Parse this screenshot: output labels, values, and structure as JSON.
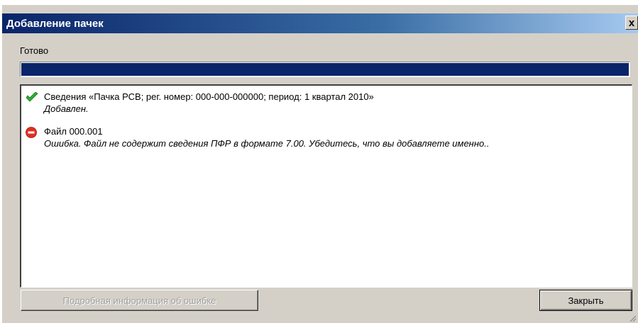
{
  "window": {
    "title": "Добавление пачек",
    "close_label": "x"
  },
  "status": {
    "label": "Готово",
    "progress_percent": 100
  },
  "log": {
    "entries": [
      {
        "icon": "check-icon",
        "title": "Сведения «Пачка РСВ; рег. номер: 000-000-000000; период: 1 квартал 2010»",
        "detail": "Добавлен."
      },
      {
        "icon": "error-icon",
        "title": "Файл 000.001",
        "detail": "Ошибка. Файл не содержит сведения ПФР в формате 7.00. Убедитесь, что вы добавляете именно.."
      }
    ]
  },
  "buttons": {
    "details_label": "Подробная информация об ошибке",
    "close_label": "Закрыть"
  },
  "colors": {
    "title_bar": "#0a246a",
    "dialog_bg": "#d4d0c8",
    "progress_fill": "#0a246a",
    "success_green": "#2fae2f",
    "error_red": "#e03020"
  }
}
